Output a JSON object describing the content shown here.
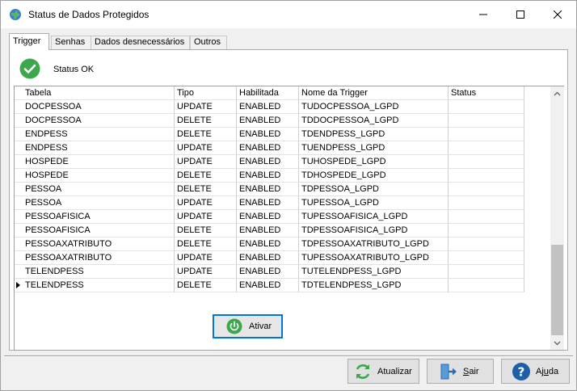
{
  "window": {
    "title": "Status de Dados Protegidos"
  },
  "tabs": [
    {
      "label": "Trigger",
      "active": true
    },
    {
      "label": "Senhas",
      "active": false
    },
    {
      "label": "Dados desnecessários",
      "active": false
    },
    {
      "label": "Outros",
      "active": false
    }
  ],
  "status": {
    "text": "Status OK",
    "icon": "check-circle-icon",
    "color": "#3aa84b"
  },
  "table": {
    "columns": [
      "Tabela",
      "Tipo",
      "Habilitada",
      "Nome da Trigger",
      "Status"
    ],
    "rows": [
      {
        "tabela": "DOCPESSOA",
        "tipo": "UPDATE",
        "habilitada": "ENABLED",
        "nome": "TUDOCPESSOA_LGPD",
        "status": ""
      },
      {
        "tabela": "DOCPESSOA",
        "tipo": "DELETE",
        "habilitada": "ENABLED",
        "nome": "TDDOCPESSOA_LGPD",
        "status": ""
      },
      {
        "tabela": "ENDPESS",
        "tipo": "DELETE",
        "habilitada": "ENABLED",
        "nome": "TDENDPESS_LGPD",
        "status": ""
      },
      {
        "tabela": "ENDPESS",
        "tipo": "UPDATE",
        "habilitada": "ENABLED",
        "nome": "TUENDPESS_LGPD",
        "status": ""
      },
      {
        "tabela": "HOSPEDE",
        "tipo": "UPDATE",
        "habilitada": "ENABLED",
        "nome": "TUHOSPEDE_LGPD",
        "status": ""
      },
      {
        "tabela": "HOSPEDE",
        "tipo": "DELETE",
        "habilitada": "ENABLED",
        "nome": "TDHOSPEDE_LGPD",
        "status": ""
      },
      {
        "tabela": "PESSOA",
        "tipo": "DELETE",
        "habilitada": "ENABLED",
        "nome": "TDPESSOA_LGPD",
        "status": ""
      },
      {
        "tabela": "PESSOA",
        "tipo": "UPDATE",
        "habilitada": "ENABLED",
        "nome": "TUPESSOA_LGPD",
        "status": ""
      },
      {
        "tabela": "PESSOAFISICA",
        "tipo": "UPDATE",
        "habilitada": "ENABLED",
        "nome": "TUPESSOAFISICA_LGPD",
        "status": ""
      },
      {
        "tabela": "PESSOAFISICA",
        "tipo": "DELETE",
        "habilitada": "ENABLED",
        "nome": "TDPESSOAFISICA_LGPD",
        "status": ""
      },
      {
        "tabela": "PESSOAXATRIBUTO",
        "tipo": "DELETE",
        "habilitada": "ENABLED",
        "nome": "TDPESSOAXATRIBUTO_LGPD",
        "status": ""
      },
      {
        "tabela": "PESSOAXATRIBUTO",
        "tipo": "UPDATE",
        "habilitada": "ENABLED",
        "nome": "TUPESSOAXATRIBUTO_LGPD",
        "status": ""
      },
      {
        "tabela": "TELENDPESS",
        "tipo": "UPDATE",
        "habilitada": "ENABLED",
        "nome": "TUTELENDPESS_LGPD",
        "status": ""
      },
      {
        "tabela": "TELENDPESS",
        "tipo": "DELETE",
        "habilitada": "ENABLED",
        "nome": "TDTELENDPESS_LGPD",
        "status": "",
        "current": true
      }
    ]
  },
  "actions": {
    "ativar_label": "Ativar"
  },
  "footer": {
    "atualizar_label": "Atualizar",
    "sair_label": "Sair",
    "ajuda_label": "Ajuda"
  },
  "colors": {
    "accent": "#0078d7",
    "ok_green": "#3aa84b",
    "sair_blue": "#2b6cb8",
    "help_blue": "#1f5fa8"
  }
}
